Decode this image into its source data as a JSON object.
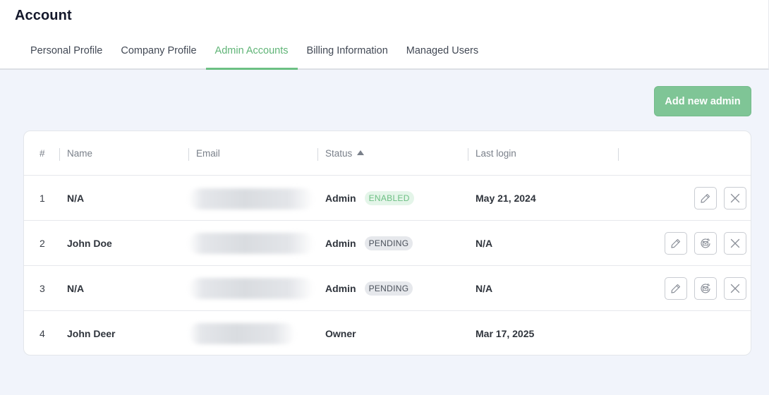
{
  "header": {
    "title": "Account"
  },
  "tabs": [
    {
      "label": "Personal Profile"
    },
    {
      "label": "Company Profile"
    },
    {
      "label": "Admin Accounts"
    },
    {
      "label": "Billing Information"
    },
    {
      "label": "Managed Users"
    }
  ],
  "active_tab": "Admin Accounts",
  "actions": {
    "add_admin": "Add new admin"
  },
  "table": {
    "columns": {
      "index": "#",
      "name": "Name",
      "email": "Email",
      "status": "Status",
      "last_login": "Last login"
    },
    "sort": {
      "column": "Status",
      "direction": "ascending",
      "icon": "sort-up-icon"
    },
    "rows": [
      {
        "index": "1",
        "name": "N/A",
        "role": "Admin",
        "badge": "ENABLED",
        "last_login": "May 21, 2024",
        "actions": [
          "edit-icon",
          "delete-icon"
        ]
      },
      {
        "index": "2",
        "name": "John Doe",
        "role": "Admin",
        "badge": "PENDING",
        "last_login": "N/A",
        "actions": [
          "edit-icon",
          "resend-invite-icon",
          "delete-icon"
        ]
      },
      {
        "index": "3",
        "name": "N/A",
        "role": "Admin",
        "badge": "PENDING",
        "last_login": "N/A",
        "actions": [
          "edit-icon",
          "resend-invite-icon",
          "delete-icon"
        ]
      },
      {
        "index": "4",
        "name": "John Deer",
        "role": "Owner",
        "badge": "",
        "last_login": "Mar 17, 2025",
        "actions": []
      }
    ]
  },
  "colors": {
    "accent": "#6cc083",
    "button": "#7fc596",
    "background": "#f1f4fb",
    "enabled_badge_bg": "#e4f5e9",
    "pending_badge_bg": "#e6e8ec"
  }
}
